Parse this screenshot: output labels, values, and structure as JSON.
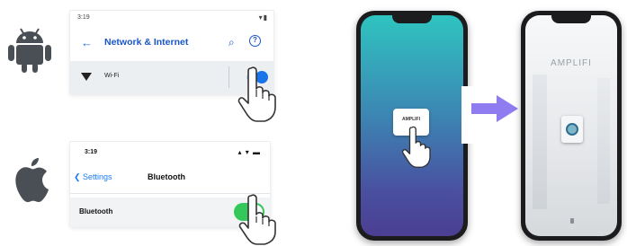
{
  "android": {
    "status_time": "3:19",
    "status_icons": "▾▮",
    "back_glyph": "←",
    "title": "Network & Internet",
    "search_glyph": "⌕",
    "help_glyph": "?",
    "wifi_label": "Wi-Fi",
    "wifi_enabled": true,
    "accent_color": "#1a73e8"
  },
  "ios": {
    "status_time": "3:19",
    "status_icons": "▴ ▾ ▬",
    "back_label": "❮ Settings",
    "title": "Bluetooth",
    "row_label": "Bluetooth",
    "bluetooth_enabled": true,
    "toggle_color": "#34c759"
  },
  "app": {
    "device_tile_label": "AMPLIFI",
    "brand_text": "AMPLIFI",
    "arrow_color": "#8f7cf0"
  },
  "icons": {
    "android": "android-logo-icon",
    "apple": "apple-logo-icon",
    "hand": "pointing-hand-icon",
    "arrow": "right-arrow-icon"
  }
}
